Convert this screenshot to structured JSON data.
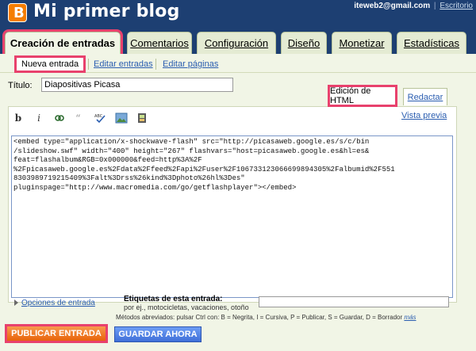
{
  "header": {
    "blog_title": "Mi primer blog",
    "user_email": "iteweb2@gmail.com",
    "separator": "|",
    "dashboard_link": "Escritorio"
  },
  "tabs": [
    {
      "label": "Creación de entradas",
      "active": true
    },
    {
      "label": "Comentarios",
      "active": false
    },
    {
      "label": "Configuración",
      "active": false
    },
    {
      "label": "Diseño",
      "active": false
    },
    {
      "label": "Monetizar",
      "active": false
    },
    {
      "label": "Estadísticas",
      "active": false
    }
  ],
  "subtabs": [
    {
      "label": "Nueva entrada",
      "active": true
    },
    {
      "label": "Editar entradas",
      "active": false
    },
    {
      "label": "Editar páginas",
      "active": false
    }
  ],
  "editor": {
    "title_label": "Título:",
    "title_value": "Diapositivas Picasa",
    "mode_html": "Edición de HTML",
    "mode_compose": "Redactar",
    "preview_link": "Vista previa",
    "toolbar": [
      "b",
      "i",
      "link-icon",
      "quote-icon",
      "spellcheck-icon",
      "image-icon",
      "video-icon"
    ],
    "content": "<embed type=\"application/x-shockwave-flash\" src=\"http://picasaweb.google.es/s/c/bin\n/slideshow.swf\" width=\"400\" height=\"267\" flashvars=\"host=picasaweb.google.es&hl=es&\nfeat=flashalbum&RGB=0x000000&feed=http%3A%2F\n%2Fpicasaweb.google.es%2Fdata%2Ffeed%2Fapi%2Fuser%2F106733123066699894305%2Falbumid%2F551\n8303989719215409%3Falt%3Drss%26kind%3Dphoto%26hl%3Des\"\npluginspage=\"http://www.macromedia.com/go/getflashplayer\"></embed>"
  },
  "footer": {
    "options_link": "Opciones de entrada",
    "labels_title": "Etiquetas de esta entrada:",
    "labels_hint": "por ej., motocicletas, vacaciones, otoño",
    "shortcuts_text": "Métodos abreviados: pulsar Ctrl con: B = Negrita, I = Cursiva, P = Publicar, S = Guardar, D = Borrador",
    "shortcuts_more": "más",
    "publish_button": "PUBLICAR ENTRADA",
    "save_button": "GUARDAR AHORA"
  },
  "colors": {
    "header_bg": "#1d3f72",
    "panel_bg": "#f1f5e6",
    "highlight": "#e8416d",
    "link": "#2a5db0",
    "publish": "#e8630a",
    "save": "#3f6fd8"
  }
}
